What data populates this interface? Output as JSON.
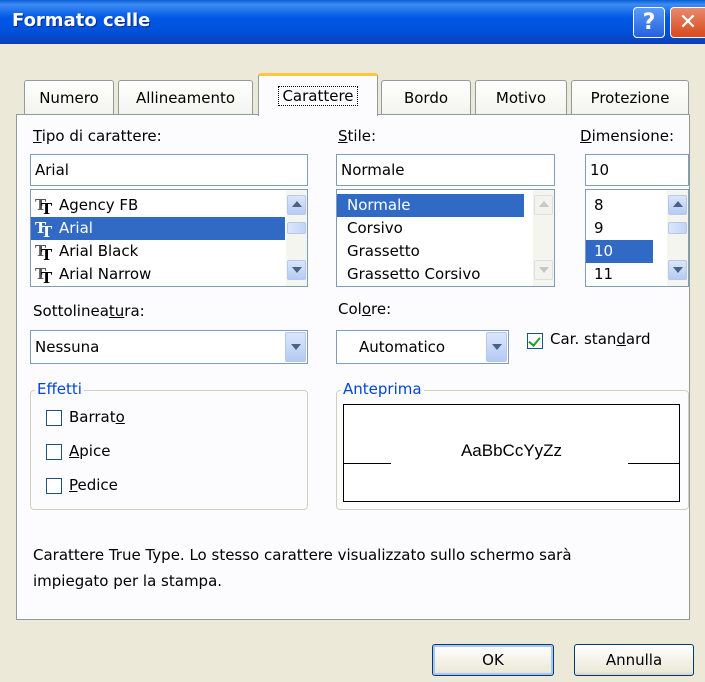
{
  "window": {
    "title": "Formato celle"
  },
  "tabs": [
    {
      "label": "Numero"
    },
    {
      "label": "Allineamento"
    },
    {
      "label": "Carattere"
    },
    {
      "label": "Bordo"
    },
    {
      "label": "Motivo"
    },
    {
      "label": "Protezione"
    }
  ],
  "font": {
    "label_pre": "",
    "label_u": "T",
    "label_post": "ipo di carattere:",
    "value": "Arial",
    "items": [
      "Agency FB",
      "Arial",
      "Arial Black",
      "Arial Narrow"
    ],
    "selected": "Arial"
  },
  "style": {
    "label_pre": "",
    "label_u": "S",
    "label_post": "tile:",
    "value": "Normale",
    "items": [
      "Normale",
      "Corsivo",
      "Grassetto",
      "Grassetto Corsivo"
    ],
    "selected": "Normale"
  },
  "size": {
    "label_pre": "",
    "label_u": "D",
    "label_post": "imensione:",
    "value": "10",
    "items": [
      "8",
      "9",
      "10",
      "11"
    ],
    "selected": "10"
  },
  "underline": {
    "label_pre": "Sottolinea",
    "label_u": "tu",
    "label_post": "ra:",
    "value": "Nessuna"
  },
  "color": {
    "label_pre": "Col",
    "label_u": "o",
    "label_post": "re:",
    "value": "Automatico"
  },
  "standard_font": {
    "label_pre": "Car. stan",
    "label_u": "d",
    "label_post": "ard",
    "checked": true
  },
  "effects": {
    "title": "Effetti",
    "items": [
      {
        "pre": "Barrat",
        "u": "o",
        "post": "",
        "checked": false
      },
      {
        "pre": "",
        "u": "A",
        "post": "pice",
        "checked": false
      },
      {
        "pre": "",
        "u": "P",
        "post": "edice",
        "checked": false
      }
    ]
  },
  "preview": {
    "title": "Anteprima",
    "sample": "AaBbCcYyZz"
  },
  "description": {
    "line1": "Carattere True Type. Lo stesso carattere visualizzato sullo schermo sarà",
    "line2": "impiegato per la stampa."
  },
  "buttons": {
    "ok": "OK",
    "cancel": "Annulla"
  },
  "icons": {
    "help": "help-icon",
    "close": "close-icon",
    "truetype": "truetype-font-icon",
    "check": "checkmark-icon",
    "arrow_up": "arrow-up-icon",
    "arrow_down": "arrow-down-icon"
  },
  "title_glyphs": {
    "help": "?",
    "close": "✕"
  }
}
